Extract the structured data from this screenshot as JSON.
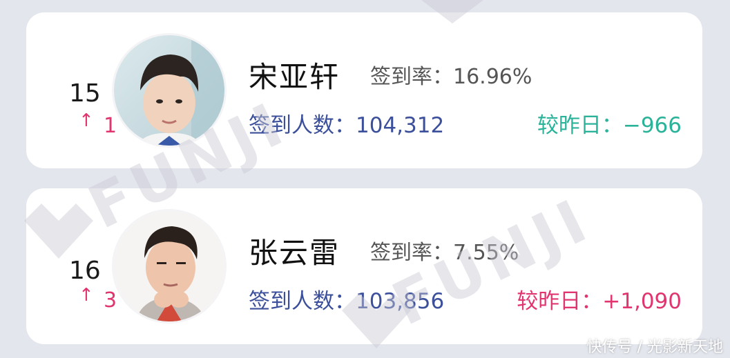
{
  "entries": [
    {
      "rank": "15",
      "change_arrow": "↑",
      "change_value": "1",
      "name": "宋亚轩",
      "rate_label": "签到率：",
      "rate_value": "16.96%",
      "count_label": "签到人数：",
      "count_value": "104,312",
      "diff_label": "较昨日：",
      "diff_value": "−966",
      "diff_color": "#2bb39a"
    },
    {
      "rank": "16",
      "change_arrow": "↑",
      "change_value": "3",
      "name": "张云雷",
      "rate_label": "签到率：",
      "rate_value": "7.55%",
      "count_label": "签到人数：",
      "count_value": "103,856",
      "diff_label": "较昨日：",
      "diff_value": "+1,090",
      "diff_color": "#e0356f"
    }
  ],
  "watermark": {
    "brand": "FUNJI",
    "footer": "快传号 / 光影新天地"
  },
  "colors": {
    "background": "#e4e6ee",
    "card": "#ffffff",
    "count_blue": "#3b4f9a",
    "up_pink": "#e0356f",
    "down_green": "#2bb39a"
  },
  "icons": [
    "up-arrow-icon",
    "avatar-photo",
    "funji-logo-icon"
  ]
}
